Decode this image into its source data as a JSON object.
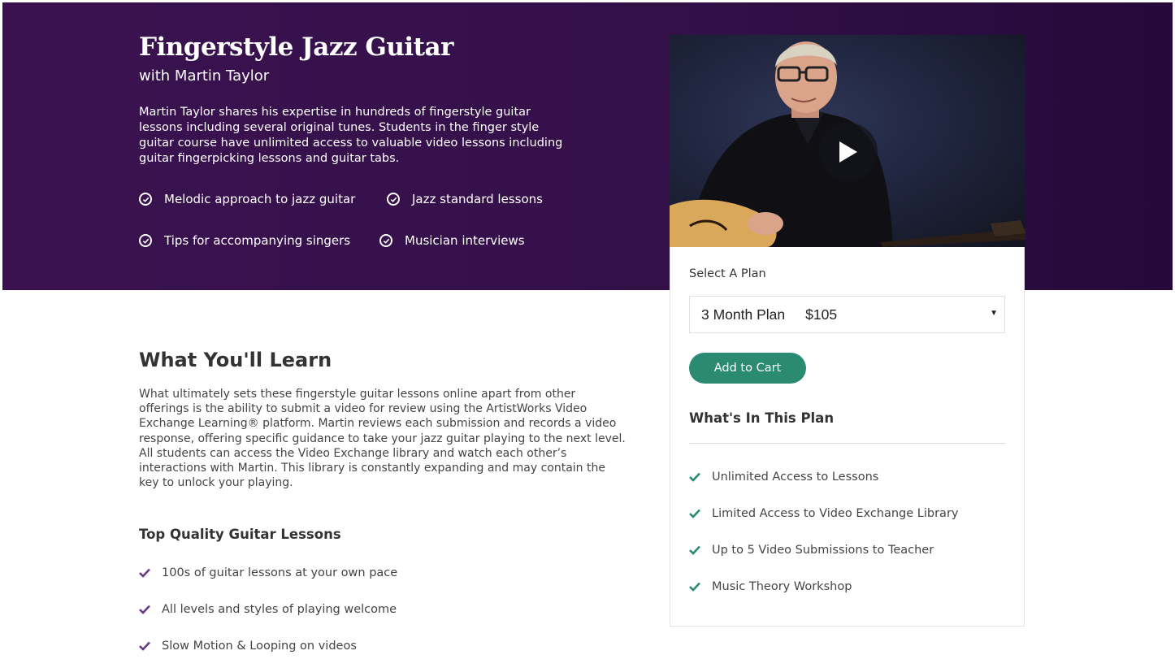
{
  "hero": {
    "title": "Fingerstyle Jazz Guitar",
    "subtitle": "with Martin Taylor",
    "description": "Martin Taylor shares his expertise in hundreds of fingerstyle guitar lessons including several original tunes. Students in the finger style guitar course have unlimited access to valuable video lessons including guitar fingerpicking lessons and guitar tabs.",
    "features": [
      "Melodic approach to jazz guitar",
      "Jazz standard lessons",
      "Tips for accompanying singers",
      "Musician interviews"
    ],
    "background_color": "#341049"
  },
  "video": {
    "play_icon": "play-icon"
  },
  "plan": {
    "label": "Select A Plan",
    "selected_plan": "3 Month Plan",
    "selected_price": "$105",
    "add_to_cart": "Add to Cart",
    "button_color": "#2a8a72",
    "heading": "What's In This Plan",
    "items": [
      "Unlimited Access to Lessons",
      "Limited Access to Video Exchange Library",
      "Up to 5 Video Submissions to Teacher",
      "Music Theory Workshop"
    ],
    "check_color": "#2a8a72"
  },
  "learn": {
    "title": "What You'll Learn",
    "body": "What ultimately sets these fingerstyle guitar lessons online apart from other offerings is the ability to submit a video for review using the ArtistWorks Video Exchange Learning® platform. Martin reviews each submission and records a video response, offering specific guidance to take your jazz guitar playing to the next level. All students can access the Video Exchange library and watch each other’s interactions with Martin. This library is constantly expanding and may contain the key to unlock your playing.",
    "quality_title": "Top Quality Guitar Lessons",
    "quality_items": [
      "100s of guitar lessons at your own pace",
      "All levels and styles of playing welcome",
      "Slow Motion & Looping on videos"
    ],
    "check_color": "#6a3a84"
  }
}
